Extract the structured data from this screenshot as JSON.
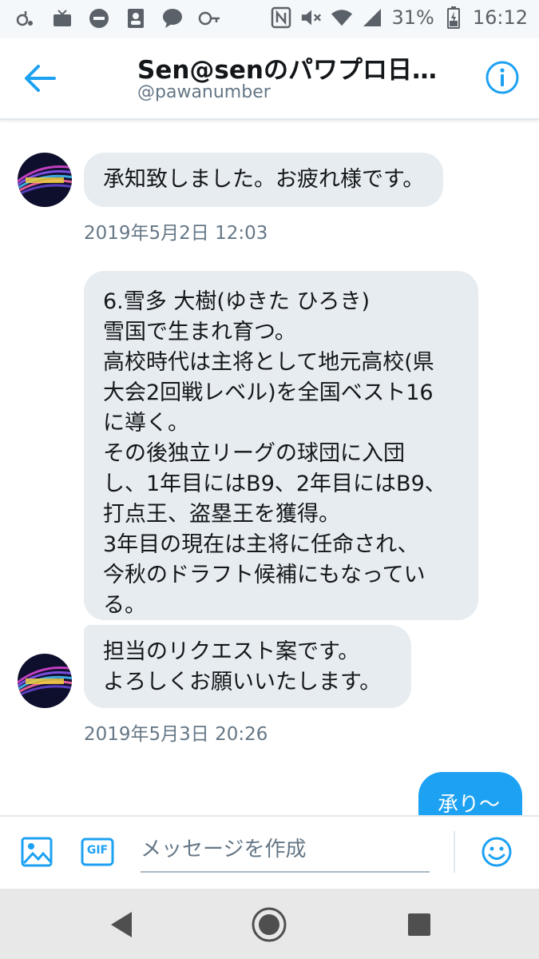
{
  "status_bar": {
    "battery": "31%",
    "time": "16:12"
  },
  "header": {
    "title": "Sen@senのパワプロ日…",
    "handle": "@pawanumber"
  },
  "messages": [
    {
      "id": "m1",
      "lines": [
        "承知致しました。お疲れ様です。"
      ],
      "timestamp": "2019年5月2日 12:03"
    },
    {
      "id": "m2",
      "lines": [
        "6.雪多 大樹(ゆきた ひろき)",
        "雪国で生まれ育つ。",
        "高校時代は主将として地元高校(県",
        "大会2回戦レベル)を全国ベスト16",
        "に導く。",
        "その後独立リーグの球団に入団",
        "し、1年目にはB9、2年目にはB9、",
        "打点王、盗塁王を獲得。",
        "3年目の現在は主将に任命され、",
        "今秋のドラフト候補にもなってい",
        "る。"
      ]
    },
    {
      "id": "m3",
      "lines": [
        "担当のリクエスト案です。",
        "よろしくお願いいたします。"
      ],
      "timestamp": "2019年5月3日 20:26"
    }
  ],
  "outgoing": {
    "text": "承り〜"
  },
  "composer": {
    "placeholder": "メッセージを作成",
    "gif_label": "GIF"
  },
  "icons": {
    "back": "arrow-left-icon",
    "info": "info-icon",
    "image": "image-icon",
    "gif": "gif-icon",
    "emoji": "emoji-icon"
  },
  "colors": {
    "accent": "#1da1f2",
    "bubble_in": "#e6ecf0",
    "text": "#14171a",
    "muted": "#657786"
  }
}
